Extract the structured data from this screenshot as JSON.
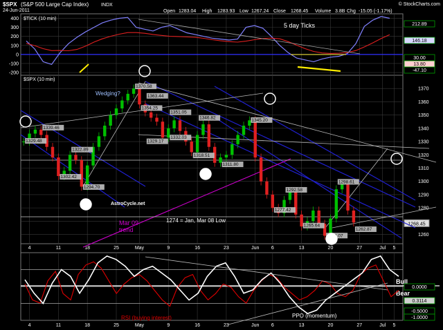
{
  "header": {
    "symbol": "$SPX",
    "name": "(S&P 500 Large Cap Index)",
    "exchange": "INDX",
    "date": "24-Jun-2011",
    "source": "© StockCharts.com",
    "open_label": "Open",
    "open": "1283.04",
    "high_label": "High",
    "high": "1283.93",
    "low_label": "Low",
    "low": "1267.24",
    "close_label": "Close",
    "close": "1268.45",
    "volume_label": "Volume",
    "volume": "3.8B",
    "chg_label": "Chg",
    "chg": "-15.05 (-1.17%)"
  },
  "colors": {
    "background": "#000000",
    "tick_line": "#8080ff",
    "tick_ma": "#e02020",
    "price_up": "#00c000",
    "price_down": "#e02020",
    "channel": "#2020d0",
    "trend": "#cc00cc",
    "rsi": "#e00000",
    "ppo": "#ffffff",
    "grid": "#3a3a3a",
    "label_bg": "#c0c0c0",
    "highlight": "#ffee00",
    "axis_box": "#00a000"
  },
  "x_axis": {
    "labels": [
      {
        "t": "4",
        "i": 1
      },
      {
        "t": "11",
        "i": 6
      },
      {
        "t": "18",
        "i": 11
      },
      {
        "t": "25",
        "i": 16
      },
      {
        "t": "May",
        "i": 20
      },
      {
        "t": "9",
        "i": 25
      },
      {
        "t": "16",
        "i": 30
      },
      {
        "t": "23",
        "i": 35
      },
      {
        "t": "Jun",
        "i": 40
      },
      {
        "t": "6",
        "i": 43
      },
      {
        "t": "13",
        "i": 48
      },
      {
        "t": "20",
        "i": 53
      },
      {
        "t": "27",
        "i": 58
      },
      {
        "t": "Jul",
        "i": 62
      },
      {
        "t": "5",
        "i": 64
      }
    ]
  },
  "tick_panel": {
    "label": "$TICK (10 min)",
    "yticks": [
      400,
      300,
      200,
      100,
      0,
      -100,
      -200
    ],
    "ylim": [
      -230,
      450
    ],
    "right_labels": [
      "212.89",
      "146.18",
      "13.80",
      "30.00",
      "-47.10"
    ],
    "annotation": "5 day Ticks"
  },
  "price_panel": {
    "label": "$SPX (10 min)",
    "yticks": [
      1370,
      1360,
      1350,
      1340,
      1330,
      1320,
      1310,
      1300,
      1290,
      1280,
      1270,
      1260
    ],
    "ylim": [
      1253,
      1380
    ],
    "last_label": "1268.45",
    "price_labels": [
      {
        "t": "1329.48",
        "i": 0,
        "v": 1329.48
      },
      {
        "t": "1339.46",
        "i": 3,
        "v": 1339.46
      },
      {
        "t": "1322.89",
        "i": 8,
        "v": 1322.89
      },
      {
        "t": "1302.42",
        "i": 6,
        "v": 1302.42
      },
      {
        "t": "1294.70",
        "i": 10,
        "v": 1294.7
      },
      {
        "t": "1370.58",
        "i": 19,
        "v": 1370.58
      },
      {
        "t": "1363.44",
        "i": 21,
        "v": 1363.44
      },
      {
        "t": "1354.25",
        "i": 20,
        "v": 1354.25
      },
      {
        "t": "1351.05",
        "i": 25,
        "v": 1351.05
      },
      {
        "t": "1329.17",
        "i": 21,
        "v": 1329.17
      },
      {
        "t": "1332.03",
        "i": 25,
        "v": 1332.03
      },
      {
        "t": "1346.82",
        "i": 30,
        "v": 1346.82
      },
      {
        "t": "1318.51",
        "i": 29,
        "v": 1318.51
      },
      {
        "t": "1311.80",
        "i": 34,
        "v": 1311.8
      },
      {
        "t": "1345.20",
        "i": 39,
        "v": 1345.2
      },
      {
        "t": "1292.58",
        "i": 45,
        "v": 1292.58
      },
      {
        "t": "1298.61",
        "i": 54,
        "v": 1298.61
      },
      {
        "t": "1277.42",
        "i": 43,
        "v": 1277.42
      },
      {
        "t": "1265.64",
        "i": 48,
        "v": 1265.64
      },
      {
        "t": "1262.87",
        "i": 57,
        "v": 1262.87
      },
      {
        "t": "1258.07",
        "i": 52,
        "v": 1258.07
      }
    ],
    "annotations": {
      "wedging": "Wedging?",
      "astro": "AstroCycle.net",
      "level": "1274 = Jan, Mar 08 Low",
      "mar_trend": "Mar 09\ntrend"
    }
  },
  "osc_panel": {
    "rsi_label": "RSI (buying interest)",
    "ppo_label": "PPO (momentum)",
    "bull_label": "Bull",
    "bear_label": "Bear",
    "right_labels": [
      "0.0000",
      "0.3114",
      "-0.5000",
      "-1.0000"
    ]
  },
  "chart_data": {
    "type": "line",
    "x": [
      0,
      1,
      2,
      3,
      4,
      5,
      6,
      7,
      8,
      9,
      10,
      11,
      12,
      13,
      14,
      15,
      16,
      17,
      18,
      19,
      20,
      21,
      22,
      23,
      24,
      25,
      26,
      27,
      28,
      29,
      30,
      31,
      32,
      33,
      34,
      35,
      36,
      37,
      38,
      39,
      40,
      41,
      42,
      43,
      44,
      45,
      46,
      47,
      48,
      49,
      50,
      51,
      52,
      53,
      54,
      55,
      56,
      57
    ],
    "series": [
      {
        "name": "$SPX (10 min)",
        "values": [
          1330,
          1336,
          1339,
          1335,
          1326,
          1318,
          1304,
          1308,
          1320,
          1316,
          1296,
          1312,
          1326,
          1334,
          1342,
          1350,
          1355,
          1361,
          1366,
          1370,
          1358,
          1352,
          1348,
          1345,
          1333,
          1340,
          1346,
          1338,
          1330,
          1322,
          1335,
          1343,
          1326,
          1314,
          1318,
          1320,
          1328,
          1335,
          1342,
          1346,
          1318,
          1300,
          1290,
          1280,
          1276,
          1286,
          1292,
          1275,
          1266,
          1270,
          1278,
          1268,
          1259,
          1272,
          1294,
          1298,
          1278,
          1269
        ]
      },
      {
        "name": "$TICK (10 min)",
        "values": [
          150,
          60,
          -80,
          -110,
          20,
          120,
          190,
          250,
          300,
          350,
          380,
          400,
          410,
          300,
          280,
          260,
          300,
          320,
          280,
          240,
          220,
          200,
          180,
          170,
          160,
          170,
          300,
          320,
          290,
          200,
          100,
          20,
          -40,
          -60,
          -80,
          -50,
          -30,
          -20,
          10,
          120,
          310,
          380,
          420,
          400
        ]
      },
      {
        "name": "RSI (buying interest)",
        "values": [
          55,
          30,
          25,
          60,
          75,
          40,
          30,
          70,
          85,
          90,
          80,
          60,
          40,
          55,
          65,
          70,
          60,
          45,
          30,
          20,
          50,
          65,
          70,
          45,
          30,
          40,
          55,
          50,
          35,
          25,
          45,
          60,
          70,
          65,
          50,
          40,
          30,
          35,
          45,
          60,
          55,
          40,
          35,
          45,
          70,
          80,
          85,
          60,
          35,
          45
        ]
      },
      {
        "name": "PPO (momentum)",
        "values": [
          0.2,
          -0.2,
          -0.5,
          0.1,
          0.5,
          0.3,
          -0.2,
          0.2,
          0.7,
          0.9,
          0.8,
          0.6,
          0.3,
          0.5,
          0.6,
          0.4,
          0.2,
          -0.1,
          -0.4,
          -0.2,
          0.3,
          0.6,
          0.7,
          0.3,
          -0.2,
          -0.1,
          0.2,
          0.4,
          0.1,
          -0.3,
          -0.6,
          -0.8,
          -0.7,
          -0.4,
          -0.2,
          0.0,
          0.2,
          0.4,
          0.8,
          0.9,
          0.5,
          0.3
        ]
      }
    ],
    "xlabel": "",
    "ylabel": ""
  }
}
